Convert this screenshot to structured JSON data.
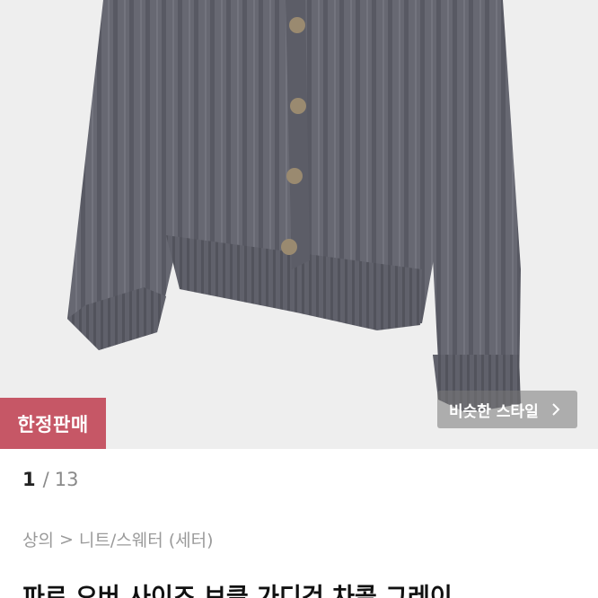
{
  "product": {
    "image_alt": "grey ribbed knit cardigan",
    "colors": {
      "background": "#eeeeee",
      "knit": "#656670",
      "button": "#9a8a70"
    }
  },
  "badge": {
    "label": "한정판매",
    "color": "#c65766"
  },
  "similar_style": {
    "label": "비슷한 스타일",
    "icon": "chevron-right-icon"
  },
  "pager": {
    "current": "1",
    "separator": "/",
    "total": "13"
  },
  "breadcrumb": {
    "category": "상의",
    "separator": ">",
    "subcategory": "니트/스웨터 (세터)"
  },
  "title": "파르 오버 사이즈 브클 가디건 차콜 그레이"
}
